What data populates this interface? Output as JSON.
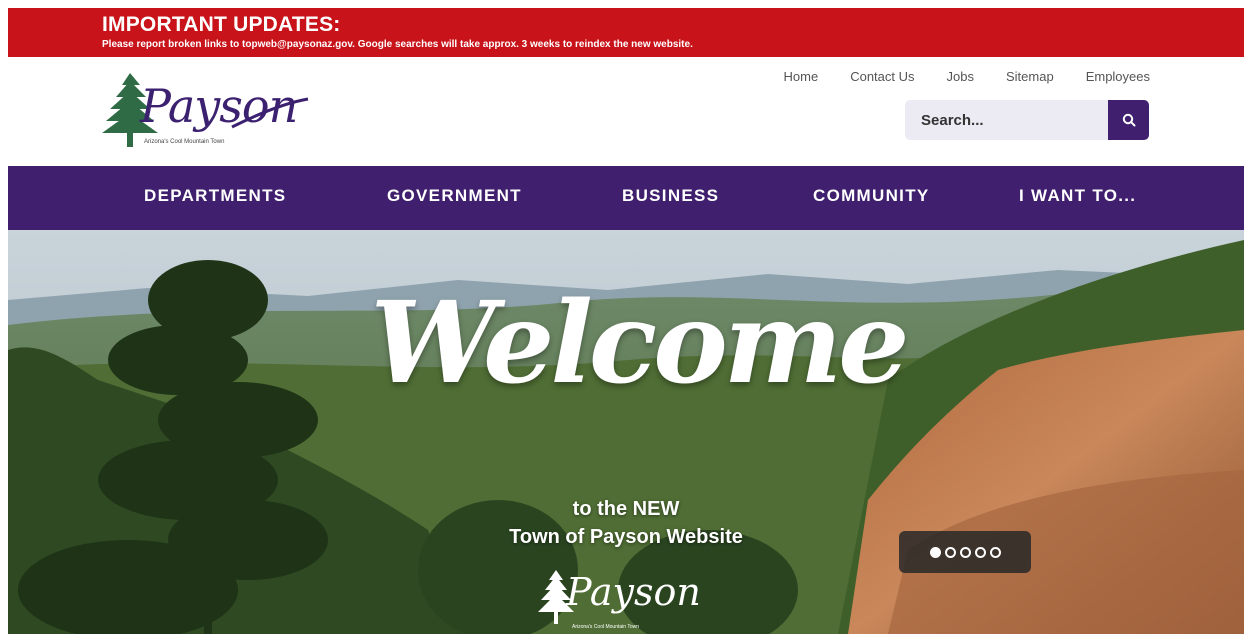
{
  "alert": {
    "title": "IMPORTANT UPDATES:",
    "text": "Please report broken links to topweb@paysonaz.gov. Google searches will take approx. 3 weeks to reindex the new website.",
    "color": "#c8131a"
  },
  "logo": {
    "name": "Payson",
    "tagline": "Arizona's Cool Mountain Town"
  },
  "utility_nav": [
    {
      "label": "Home"
    },
    {
      "label": "Contact Us"
    },
    {
      "label": "Jobs"
    },
    {
      "label": "Sitemap"
    },
    {
      "label": "Employees"
    }
  ],
  "search": {
    "placeholder": "Search...",
    "icon": "search-icon"
  },
  "main_nav": {
    "color": "#3f1f6e",
    "items": [
      {
        "label": "DEPARTMENTS"
      },
      {
        "label": "GOVERNMENT"
      },
      {
        "label": "BUSINESS"
      },
      {
        "label": "COMMUNITY"
      },
      {
        "label": "I WANT TO..."
      }
    ]
  },
  "hero": {
    "welcome": "Welcome",
    "line1": "to the NEW",
    "line2": "Town of Payson Website",
    "logo_name": "Payson",
    "logo_tagline": "Arizona's Cool Mountain Town",
    "slides_total": 5,
    "active_slide": 1
  }
}
